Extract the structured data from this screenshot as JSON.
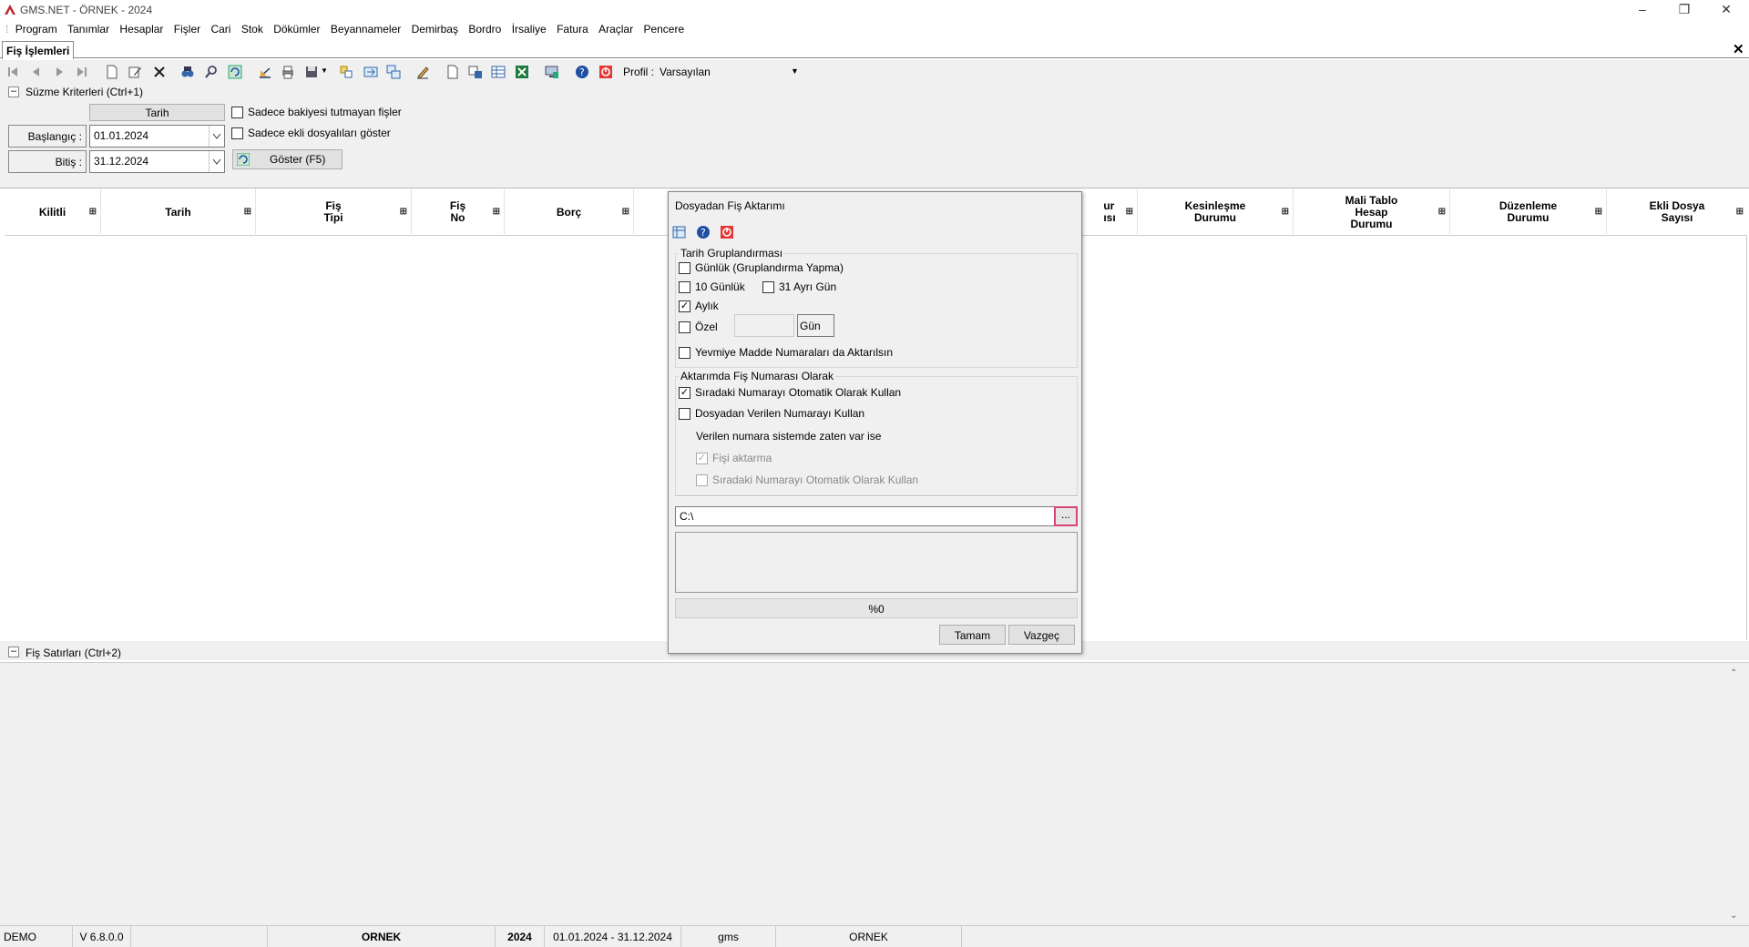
{
  "window": {
    "title": "GMS.NET - ÖRNEK - 2024"
  },
  "menu": [
    "Program",
    "Tanımlar",
    "Hesaplar",
    "Fişler",
    "Cari",
    "Stok",
    "Dökümler",
    "Beyannameler",
    "Demirbaş",
    "Bordro",
    "İrsaliye",
    "Fatura",
    "Araçlar",
    "Pencere"
  ],
  "tab": {
    "label": "Fiş İşlemleri"
  },
  "toolbar": {
    "profile_label": "Profil :",
    "profile_value": "Varsayılan"
  },
  "filter": {
    "group_label": "Süzme Kriterleri (Ctrl+1)",
    "tarih_header": "Tarih",
    "start_label": "Başlangıç :",
    "start_value": "01.01.2024",
    "end_label": "Bitiş :",
    "end_value": "31.12.2024",
    "show_button": "Göster (F5)",
    "opt1": "Sadece bakiyesi tutmayan fişler",
    "opt2": "Sadece ekli dosyalıları göster"
  },
  "grid": {
    "columns": [
      {
        "l1": "Kilitli",
        "l2": "",
        "l3": ""
      },
      {
        "l1": "Tarih",
        "l2": "",
        "l3": ""
      },
      {
        "l1": "Fiş",
        "l2": "Tipi",
        "l3": ""
      },
      {
        "l1": "Fiş",
        "l2": "No",
        "l3": ""
      },
      {
        "l1": "Borç",
        "l2": "",
        "l3": ""
      },
      {
        "l1": "ur",
        "l2": "ısı",
        "l3": ""
      },
      {
        "l1": "Kesinleşme",
        "l2": "Durumu",
        "l3": ""
      },
      {
        "l1": "Mali Tablo",
        "l2": "Hesap",
        "l3": "Durumu"
      },
      {
        "l1": "Düzenleme",
        "l2": "Durumu",
        "l3": ""
      },
      {
        "l1": "Ekli Dosya",
        "l2": "Sayısı",
        "l3": ""
      }
    ]
  },
  "lines": {
    "group_label": "Fiş Satırları (Ctrl+2)"
  },
  "dialog": {
    "title": "Dosyadan Fiş Aktarımı",
    "group1": "Tarih Gruplandırması",
    "daily": "Günlük (Gruplandırma Yapma)",
    "ten_day": "10 Günlük",
    "day31": "31 Ayrı Gün",
    "monthly": "Aylık",
    "custom": "Özel",
    "custom_value": "",
    "day_button": "Gün",
    "yevmiye": "Yevmiye Madde Numaraları da Aktarılsın",
    "group2": "Aktarımda Fiş Numarası Olarak",
    "auto_num": "Sıradaki Numarayı Otomatik Olarak Kullan",
    "file_num": "Dosyadan Verilen Numarayı Kullan",
    "exists_text": "Verilen numara sistemde zaten var ise",
    "skip": "Fişi aktarma",
    "auto_num2": "Sıradaki Numarayı Otomatik Olarak Kullan",
    "path": "C:\\",
    "browse": "...",
    "progress_text": "%0",
    "progress": 0,
    "ok": "Tamam",
    "cancel": "Vazgeç",
    "checked": {
      "daily": false,
      "ten_day": false,
      "day31": false,
      "monthly": true,
      "custom": false,
      "yevmiye": false,
      "auto_num": true,
      "file_num": false,
      "skip": true,
      "auto_num2": false
    }
  },
  "status": {
    "mode": "DEMO",
    "version": "V 6.8.0.0",
    "company": "ORNEK",
    "year": "2024",
    "range": "01.01.2024 - 31.12.2024",
    "user": "gms",
    "db": "ORNEK"
  }
}
